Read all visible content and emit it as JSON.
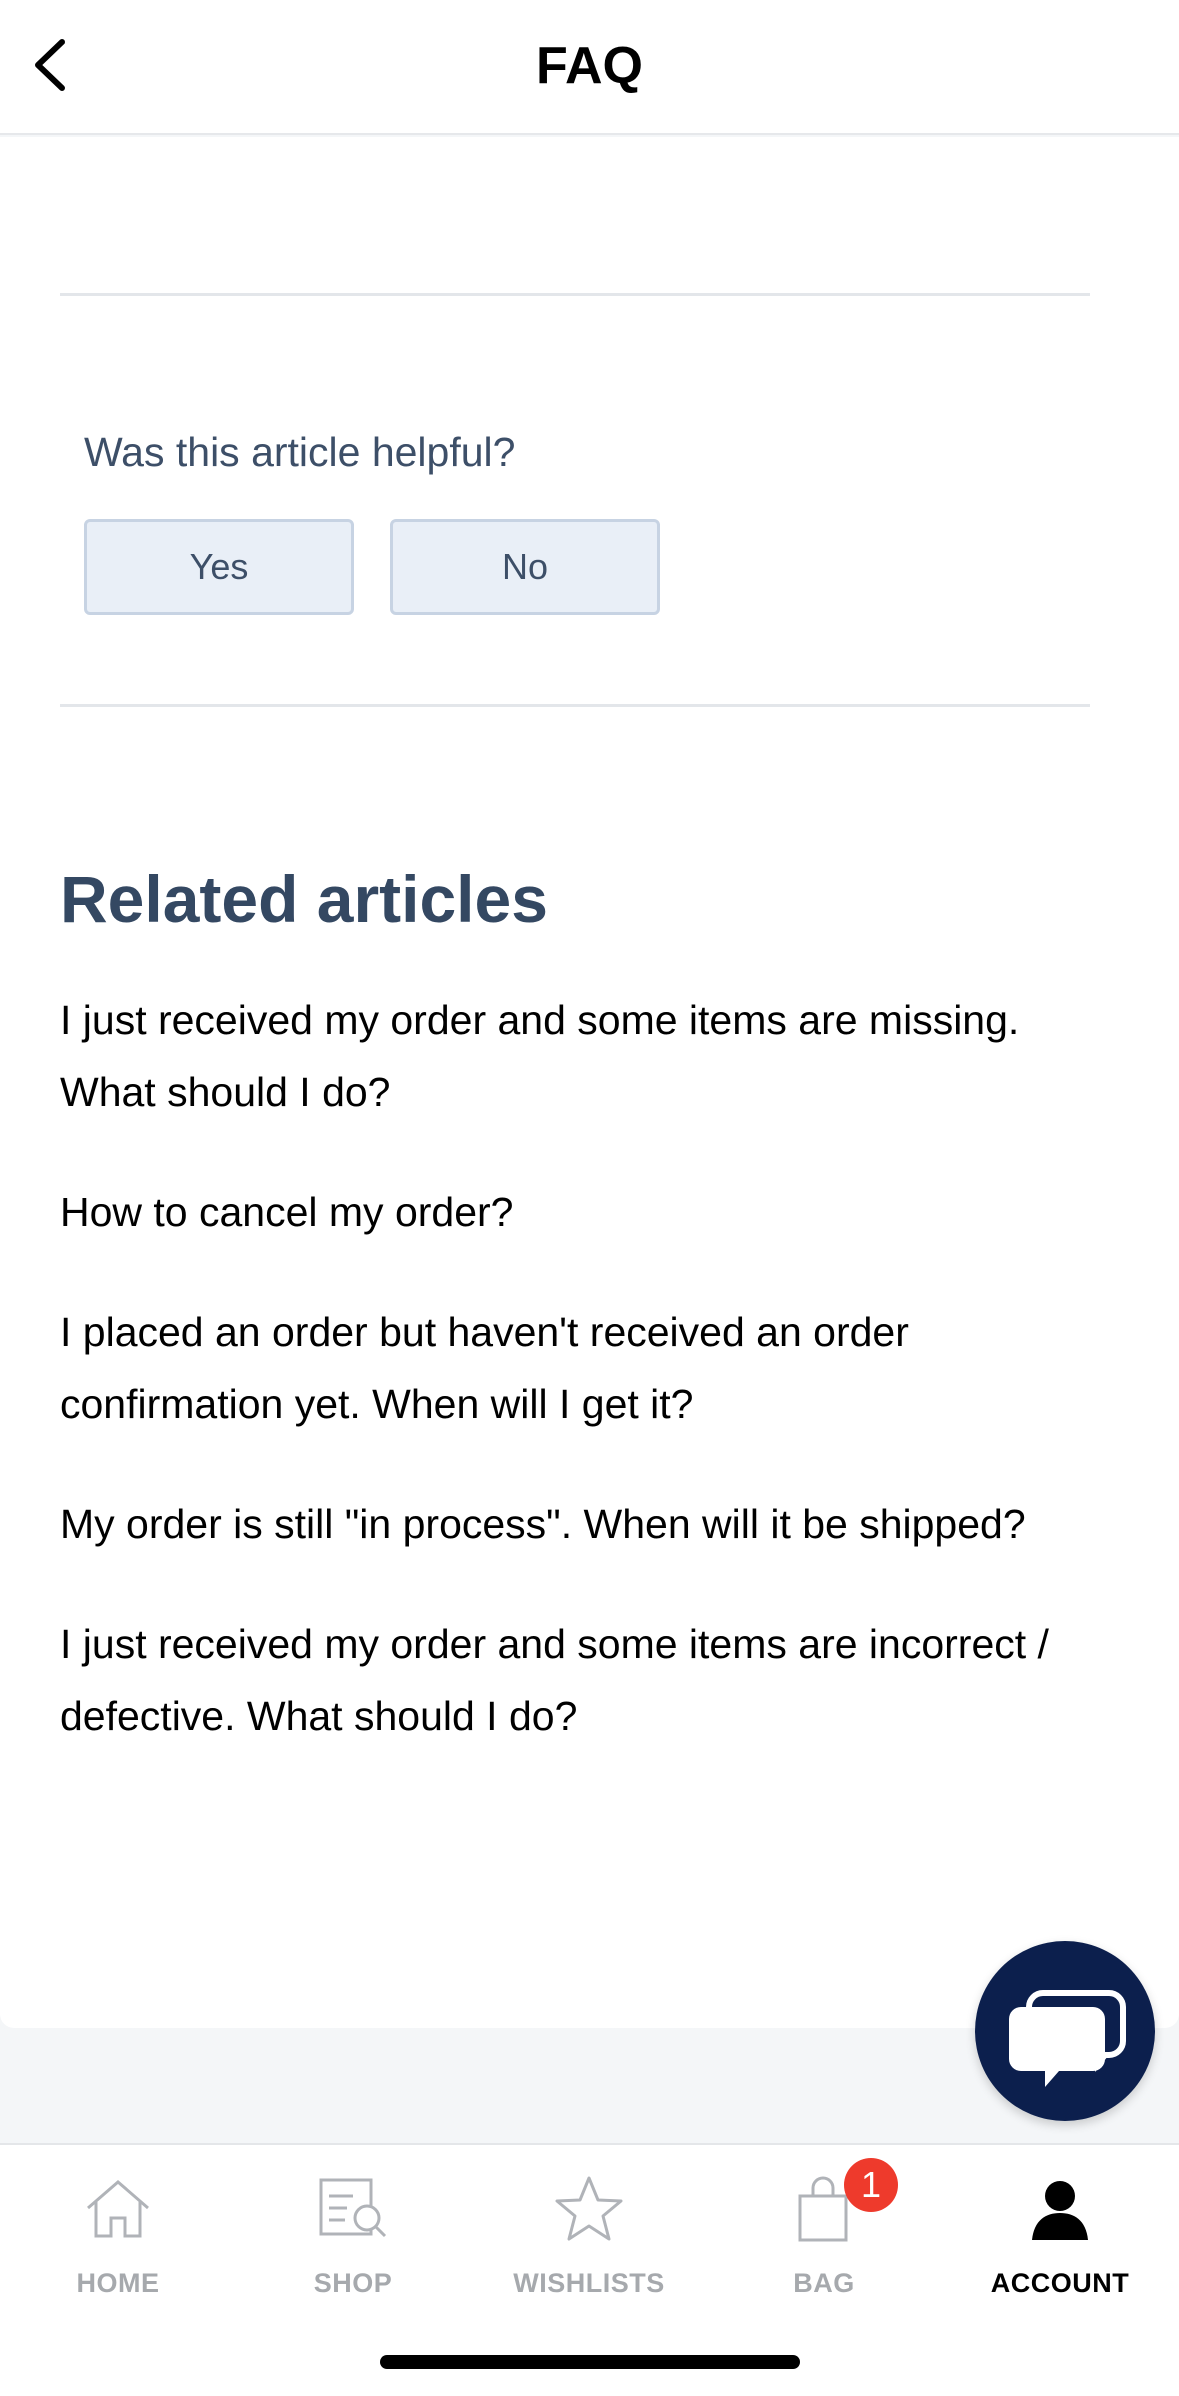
{
  "header": {
    "title": "FAQ",
    "back_icon": "chevron-left-icon"
  },
  "feedback": {
    "question": "Was this article helpful?",
    "yes_label": "Yes",
    "no_label": "No"
  },
  "related": {
    "title": "Related articles",
    "articles": [
      "I just received my order and some items are missing. What should I do?",
      "How to cancel my order?",
      "I placed an order but haven't received an order confirmation yet. When will I get it?",
      "My order is still \"in process\". When will it be shipped?",
      "I just received my order and some items are incorrect / defective. What should I do?"
    ]
  },
  "chat": {
    "icon": "chat-bubble-icon"
  },
  "tabbar": {
    "home_label": "HOME",
    "shop_label": "SHOP",
    "wishlists_label": "WISHLISTS",
    "bag_label": "BAG",
    "bag_count": "1",
    "account_label": "ACCOUNT",
    "active_tab": "ACCOUNT"
  },
  "colors": {
    "heading": "#344862",
    "button_bg": "#e9eff7",
    "chat_bg": "#0c1f4d",
    "badge": "#ee3a2c"
  }
}
